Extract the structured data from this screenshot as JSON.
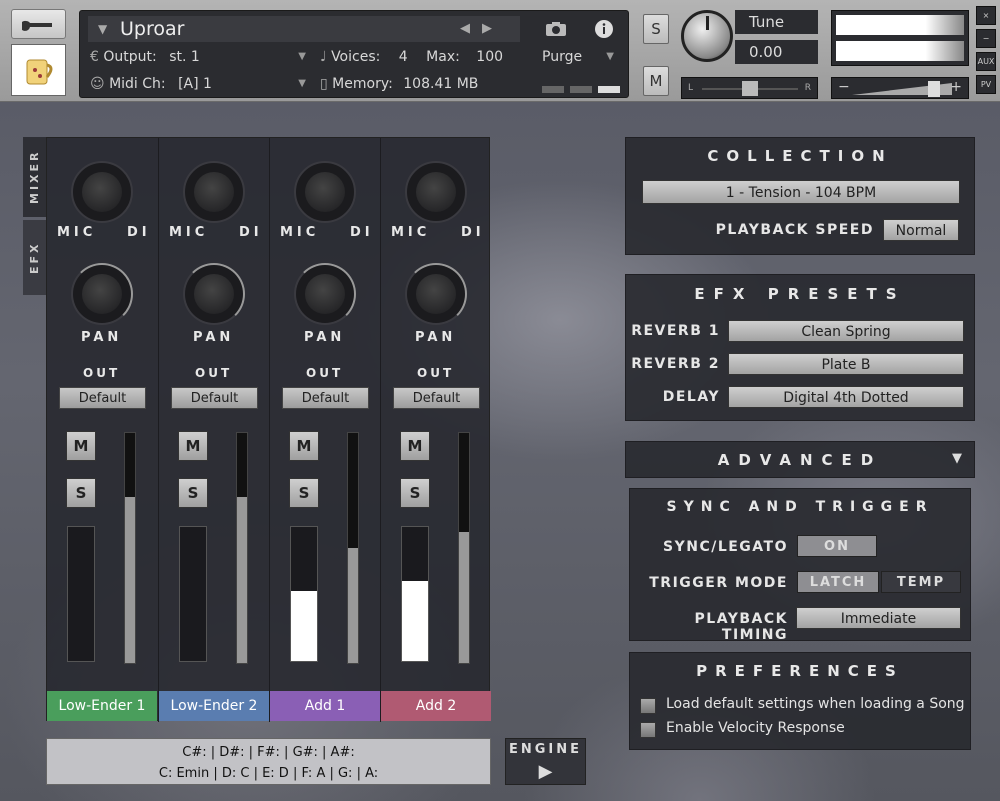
{
  "header": {
    "title": "Uproar",
    "output_label": "Output:",
    "output_value": "st. 1",
    "voices_label": "Voices:",
    "voices_value": "4",
    "max_label": "Max:",
    "max_value": "100",
    "purge_label": "Purge",
    "midi_label": "Midi Ch:",
    "midi_value": "[A]  1",
    "memory_label": "Memory:",
    "memory_value": "108.41 MB",
    "solo": "S",
    "mute": "M",
    "tune_label": "Tune",
    "tune_value": "0.00",
    "pan_l": "L",
    "pan_r": "R",
    "vol_minus": "−",
    "vol_plus": "+",
    "side_buttons": [
      "×",
      "−",
      "AUX",
      "PV"
    ]
  },
  "tabs": {
    "mixer": "MIXER",
    "efx": "EFX"
  },
  "mixer": {
    "mic_label": "MIC",
    "di_label": "DI",
    "pan_label": "PAN",
    "out_label": "OUT",
    "m_label": "M",
    "s_label": "S",
    "channels": [
      {
        "name": "Low-Ender 1",
        "out": "Default",
        "color": "#4a9e5c",
        "fader_fill": 0.0,
        "level": 0.72
      },
      {
        "name": "Low-Ender 2",
        "out": "Default",
        "color": "#5a7db0",
        "fader_fill": 0.0,
        "level": 0.72
      },
      {
        "name": "Add 1",
        "out": "Default",
        "color": "#8a5fb5",
        "fader_fill": 0.52,
        "level": 0.5
      },
      {
        "name": "Add 2",
        "out": "Default",
        "color": "#b05a72",
        "fader_fill": 0.6,
        "level": 0.57
      }
    ]
  },
  "keys": {
    "line1": "C#:    | D#:    | F#:    | G#:    | A#:",
    "line2": "C: Emin | D: C | E: D | F: A | G:    | A:"
  },
  "engine": {
    "label": "ENGINE"
  },
  "collection": {
    "title": "COLLECTION",
    "selected": "1 - Tension - 104 BPM",
    "speed_label": "PLAYBACK SPEED",
    "speed_value": "Normal"
  },
  "efx_presets": {
    "title": "EFX PRESETS",
    "reverb1_label": "REVERB 1",
    "reverb1_value": "Clean Spring",
    "reverb2_label": "REVERB 2",
    "reverb2_value": "Plate B",
    "delay_label": "DELAY",
    "delay_value": "Digital 4th Dotted"
  },
  "advanced": {
    "title": "ADVANCED"
  },
  "sync": {
    "title": "SYNC AND TRIGGER",
    "legato_label": "SYNC/LEGATO",
    "legato_value": "ON",
    "trigger_label": "TRIGGER MODE",
    "latch": "LATCH",
    "temp": "TEMP",
    "timing_label": "PLAYBACK TIMING",
    "timing_value": "Immediate"
  },
  "preferences": {
    "title": "PREFERENCES",
    "option1": "Load default settings when loading a Song",
    "option2": "Enable Velocity Response"
  }
}
